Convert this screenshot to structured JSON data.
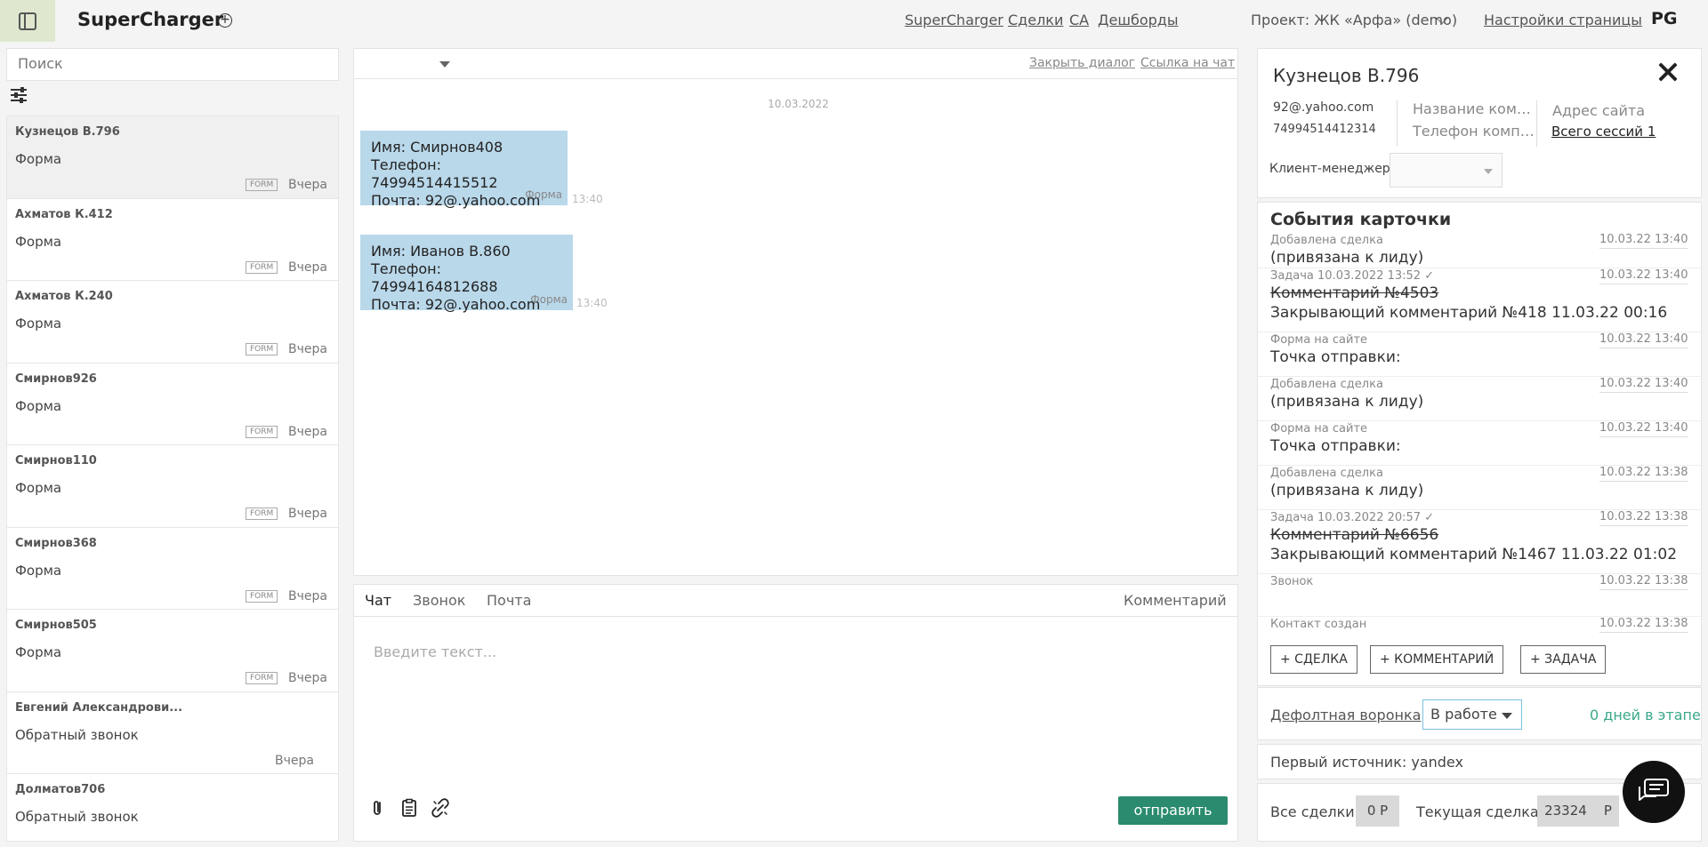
{
  "header": {
    "app_title": "SuperCharger",
    "nav": [
      "SuperCharger",
      "Сделки",
      "CA",
      "Дешборды"
    ],
    "project": "Проект: ЖК «Арфа» (demo)",
    "page_settings": "Настройки страницы",
    "user_initials": "PG"
  },
  "left": {
    "search_placeholder": "Поиск",
    "leads": [
      {
        "name": "Кузнецов В.796",
        "type": "Форма",
        "tag": "FORM",
        "time": "Вчера"
      },
      {
        "name": "Ахматов К.412",
        "type": "Форма",
        "tag": "FORM",
        "time": "Вчера"
      },
      {
        "name": "Ахматов К.240",
        "type": "Форма",
        "tag": "FORM",
        "time": "Вчера"
      },
      {
        "name": "Смирнов926",
        "type": "Форма",
        "tag": "FORM",
        "time": "Вчера"
      },
      {
        "name": "Смирнов110",
        "type": "Форма",
        "tag": "FORM",
        "time": "Вчера"
      },
      {
        "name": "Смирнов368",
        "type": "Форма",
        "tag": "FORM",
        "time": "Вчера"
      },
      {
        "name": "Смирнов505",
        "type": "Форма",
        "tag": "FORM",
        "time": "Вчера"
      },
      {
        "name": "Евгений Александрови...",
        "type": "Обратный звонок",
        "tag": "",
        "time": "Вчера"
      },
      {
        "name": "Долматов706",
        "type": "Обратный звонок",
        "tag": "",
        "time": ""
      }
    ]
  },
  "chat": {
    "close_dialog": "Закрыть диалог",
    "chat_link": "Ссылка на чат",
    "date": "10.03.2022",
    "messages": [
      {
        "lines": [
          "Имя: Смирнов408",
          "Телефон: 74994514415512",
          "Почта: 92@.yahoo.com"
        ],
        "tag": "Форма",
        "time": "13:40"
      },
      {
        "lines": [
          "Имя: Иванов В.860",
          "Телефон: 74994164812688",
          "Почта: 92@.yahoo.com"
        ],
        "tag": "Форма",
        "time": "13:40"
      }
    ],
    "tabs": [
      "Чат",
      "Звонок",
      "Почта"
    ],
    "comment_tab": "Комментарий",
    "input_placeholder": "Введите текст...",
    "send_label": "отправить"
  },
  "card": {
    "name": "Кузнецов В.796",
    "email": "92@.yahoo.com",
    "phone": "74994514412314",
    "company_name": "Название компа...",
    "company_phone": "Телефон компан...",
    "site_address": "Адрес сайта",
    "all_sessions": "Всего сессий 1",
    "client_manager_label": "Клиент-менеджер"
  },
  "events": {
    "title": "События карточки",
    "items": [
      {
        "meta": "Добавлена сделка",
        "time": "10.03.22 13:40",
        "lines": [
          {
            "text": "(привязана к лиду)",
            "strike": false
          }
        ]
      },
      {
        "meta": "Задача  10.03.2022 13:52 ✓",
        "time": "10.03.22 13:40",
        "lines": [
          {
            "text": "Комментарий №4503",
            "strike": true
          },
          {
            "text": "Закрывающий комментарий №418  11.03.22 00:16",
            "strike": false
          }
        ]
      },
      {
        "meta": "Форма на сайте",
        "time": "10.03.22 13:40",
        "lines": [
          {
            "text": "Точка отправки:",
            "strike": false
          }
        ]
      },
      {
        "meta": "Добавлена сделка",
        "time": "10.03.22 13:40",
        "lines": [
          {
            "text": "(привязана к лиду)",
            "strike": false
          }
        ]
      },
      {
        "meta": "Форма на сайте",
        "time": "10.03.22 13:40",
        "lines": [
          {
            "text": "Точка отправки:",
            "strike": false
          }
        ]
      },
      {
        "meta": "Добавлена сделка",
        "time": "10.03.22 13:38",
        "lines": [
          {
            "text": "(привязана к лиду)",
            "strike": false
          }
        ]
      },
      {
        "meta": "Задача  10.03.2022 20:57 ✓",
        "time": "10.03.22 13:38",
        "lines": [
          {
            "text": "Комментарий №6656",
            "strike": true
          },
          {
            "text": "Закрывающий комментарий №1467  11.03.22 01:02",
            "strike": false
          }
        ]
      },
      {
        "meta": "Звонок",
        "time": "10.03.22 13:38",
        "lines": [
          {
            "text": " ",
            "strike": false
          }
        ]
      },
      {
        "meta": "Контакт создан",
        "time": "10.03.22 13:38",
        "lines": []
      }
    ],
    "actions": [
      "+ СДЕЛКА",
      "+ КОММЕНТАРИЙ",
      "+ ЗАДАЧА"
    ]
  },
  "funnel": {
    "name": "Дефолтная воронка",
    "stage": "В работе",
    "days": "0 дней в этапе",
    "first_source": "Первый источник: yandex"
  },
  "deals": {
    "all_label": "Все сделки:",
    "all_value": "0 Р",
    "current_label": "Текущая сделка:",
    "current_value": "23324",
    "current_currency": "Р"
  }
}
